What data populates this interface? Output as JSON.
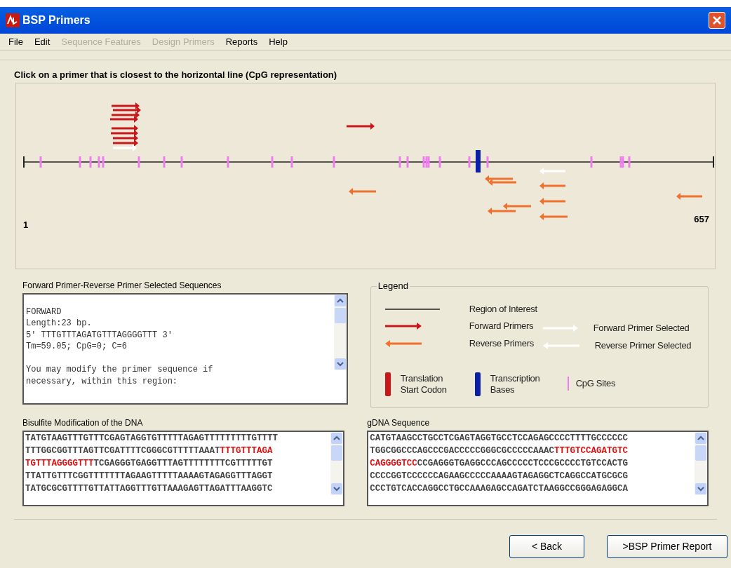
{
  "window": {
    "title": "BSP Primers"
  },
  "menu": [
    {
      "label": "File",
      "disabled": false
    },
    {
      "label": "Edit",
      "disabled": false
    },
    {
      "label": "Sequence Features",
      "disabled": true
    },
    {
      "label": "Design Primers",
      "disabled": true
    },
    {
      "label": "Reports",
      "disabled": false
    },
    {
      "label": "Help",
      "disabled": false
    }
  ],
  "instruction": "Click on a primer that is closest to the horizontal line (CpG representation)",
  "map": {
    "start_label": "1",
    "end_label": "657",
    "primers": [
      {
        "kind": "forward",
        "selected": false
      },
      {
        "kind": "forward",
        "selected": false
      },
      {
        "kind": "forward",
        "selected": false
      },
      {
        "kind": "forward",
        "selected": false
      },
      {
        "kind": "forward",
        "selected": false
      },
      {
        "kind": "forward",
        "selected": false
      },
      {
        "kind": "forward",
        "selected": false
      },
      {
        "kind": "forward",
        "selected": false
      },
      {
        "kind": "forward",
        "selected": true
      },
      {
        "kind": "forward",
        "selected": false
      },
      {
        "kind": "reverse",
        "selected": false
      },
      {
        "kind": "reverse",
        "selected": false
      },
      {
        "kind": "reverse",
        "selected": false
      },
      {
        "kind": "reverse",
        "selected": true
      },
      {
        "kind": "reverse",
        "selected": false
      },
      {
        "kind": "reverse",
        "selected": false
      },
      {
        "kind": "reverse",
        "selected": false
      },
      {
        "kind": "reverse",
        "selected": false
      },
      {
        "kind": "reverse",
        "selected": false
      },
      {
        "kind": "reverse",
        "selected": false
      }
    ]
  },
  "selected_sequences": {
    "label": "Forward Primer-Reverse Primer Selected Sequences",
    "paragraphs": [
      [
        "FORWARD",
        "Length:23 bp.",
        "5' TTTGTTTAGATGTTTAGGGGTTT 3'",
        "Tm=59.05; CpG=0; C=6"
      ],
      [
        "You may modify the primer sequence if",
        "necessary, within this region:"
      ]
    ]
  },
  "legend": {
    "title": "Legend",
    "items": [
      {
        "kind": "region",
        "label": "Region of Interest"
      },
      {
        "kind": "forward",
        "label": "Forward Primers"
      },
      {
        "kind": "forward_selected",
        "label": "Forward Primer Selected"
      },
      {
        "kind": "reverse",
        "label": "Reverse Primers"
      },
      {
        "kind": "reverse_selected",
        "label": "Reverse Primer Selected"
      },
      {
        "kind": "start_codon",
        "label": "Translation Start Codon"
      },
      {
        "kind": "transcription",
        "label": "Transcription Bases"
      },
      {
        "kind": "cpg",
        "label": "CpG Sites"
      }
    ]
  },
  "bisulfite": {
    "label": "Bisulfite Modification of the DNA",
    "lines": [
      "TATGTAAGTTTGTTTCGAGTAGGTGTTTTTAGAGTTTTTTTTTGTTTT",
      "TTTGGCGGTTTAGTTCGATTTTCGGGCGTTTTTAAAT**TTTGTTTAGA**",
      "**TGTTTAGGGGTTT**TCGAGGGTGAGGTTTAGTTTTTTTTCGTTTTTGT",
      "TTATTGTTTCGGTTTTTTTAGAAGTTTTTAAAAGTAGAGGTTTAGGT",
      "TATGCGCGTTTTGTTATTAGGTTTGTTAAAGAGTTAGATTTAAGGTC"
    ]
  },
  "gdna": {
    "label": "gDNA Sequence",
    "lines": [
      "CATGTAAGCCTGCCTCGAGTAGGTGCCTCCAGAGCCCCTTTTGCCCCCC",
      "TGGCGGCCCAGCCCGACCCCCGGGCGCCCCCAAAC**TTTGTCCAGATGTC**",
      "**CAGGGGTCC**CCGAGGGTGAGGCCCAGCCCCCTCCCGCCCCTGTCCACTG",
      "CCCCGGTCCCCCCAGAAGCCCCCAAAAGTAGAGGCTCAGGCCATGCGCG",
      "CCCTGTCACCAGGCCTGCCAAAGAGCCAGATCTAAGGCCGGGAGAGGCA"
    ]
  },
  "buttons": [
    {
      "label": "< Back"
    },
    {
      "label": ">BSP Primer Report"
    }
  ]
}
